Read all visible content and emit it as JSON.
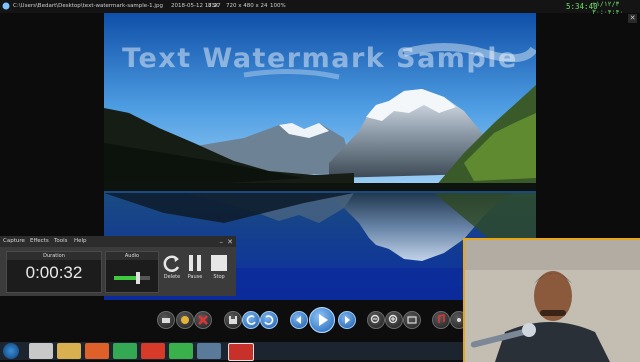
{
  "titlebar": {
    "path": "C:\\Users\\Bedart\\Desktop\\text-watermark-sample-1.jpg",
    "date": "2018-05-12 17:27",
    "size": "83K",
    "dims": "720 x 480 x 24",
    "zoom": "100%",
    "clock1": "5:34:40",
    "clock2": "+۱/۱۲/۳ ۳۰:۰۴:۴۰"
  },
  "image": {
    "watermark": "Text Watermark Sample"
  },
  "recorder": {
    "menu": [
      "Capture",
      "Effects",
      "Tools",
      "Help"
    ],
    "duration_label": "Duration",
    "duration": "0:00:32",
    "audio_label": "Audio",
    "audio_level": 0.7,
    "buttons": {
      "delete": "Delete",
      "pause": "Pause",
      "stop": "Stop"
    },
    "minimize": "–",
    "close": "✕"
  },
  "close_glyph": "✕",
  "colors": {
    "accent": "#1b63b8",
    "rec_green": "#3fc93f",
    "webcam_border": "#e8a71a"
  }
}
